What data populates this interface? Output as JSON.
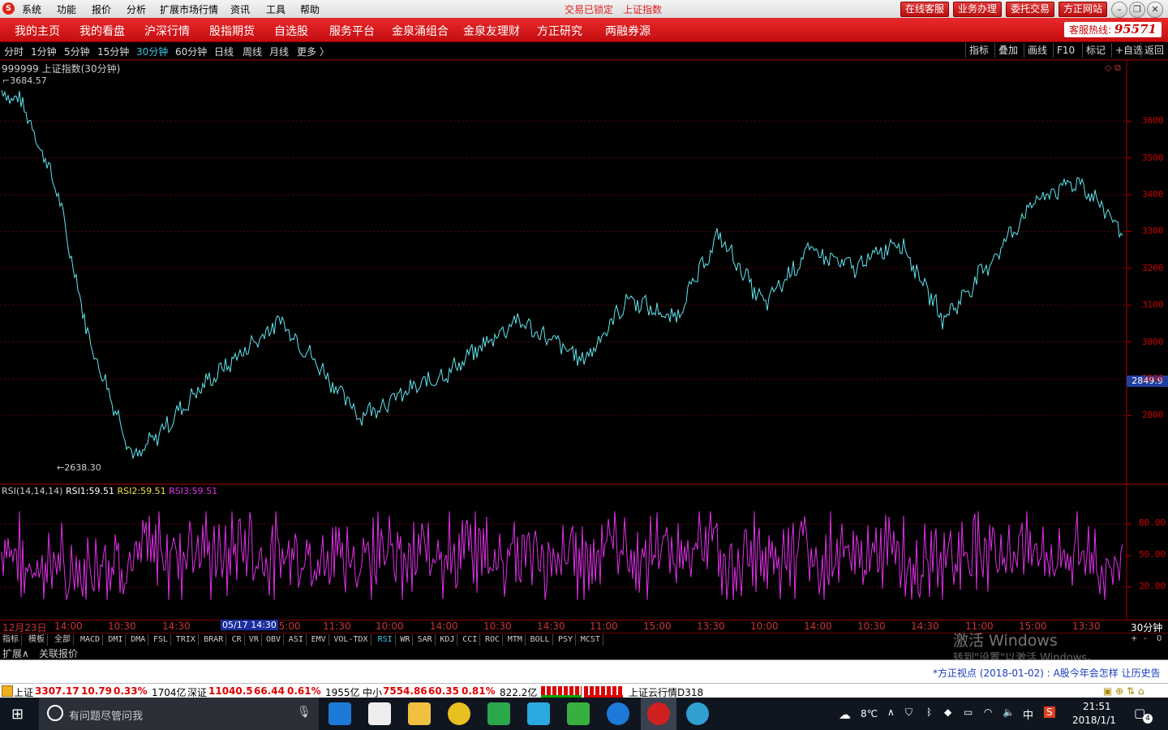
{
  "menubar": {
    "items": [
      "系统",
      "功能",
      "报价",
      "分析",
      "扩展市场行情",
      "资讯",
      "工具",
      "帮助"
    ],
    "status_locked": "交易已锁定",
    "status_index": "上证指数",
    "buttons": [
      "在线客服",
      "业务办理",
      "委托交易",
      "方正网站"
    ]
  },
  "navbar": {
    "items": [
      "我的主页",
      "我的看盘",
      "沪深行情",
      "股指期货",
      "自选股",
      "服务平台",
      "金泉涌组合",
      "金泉友理财",
      "方正研究",
      "两融券源"
    ],
    "hotline_label": "客服热线:",
    "hotline_number": "95571"
  },
  "periods": {
    "items": [
      "分时",
      "1分钟",
      "5分钟",
      "15分钟",
      "30分钟",
      "60分钟",
      "日线",
      "周线",
      "月线",
      "更多 〉"
    ],
    "active": "30分钟",
    "right_tools": [
      "指标",
      "叠加",
      "画线",
      "F10",
      "标记",
      "+自选",
      "返回"
    ]
  },
  "chart_data": [
    {
      "type": "line",
      "title": "999999 上证指数(30分钟)",
      "high_label": "3684.57",
      "low_label": "2638.30",
      "current_price": "2849.9",
      "yticks": [
        "3600",
        "3500",
        "3400",
        "3300",
        "3200",
        "3100",
        "3000",
        "2900",
        "2800"
      ],
      "ylim": [
        2620,
        3700
      ],
      "keypoints": {
        "x": [
          0,
          2,
          5,
          8,
          12,
          18,
          25,
          32,
          40,
          46,
          52,
          56,
          60,
          64,
          68,
          72,
          76,
          80,
          84,
          88,
          92,
          96,
          100
        ],
        "y": [
          3680,
          3650,
          3420,
          3000,
          2680,
          2880,
          3060,
          2800,
          2920,
          3060,
          2950,
          3120,
          3060,
          3290,
          3100,
          3250,
          3200,
          3280,
          3060,
          3210,
          3380,
          3440,
          3300
        ]
      }
    },
    {
      "type": "line",
      "title": "RSI(14,14,14)",
      "series": [
        {
          "name": "RSI1",
          "value": "59.51"
        },
        {
          "name": "RSI2",
          "value": "59.51"
        },
        {
          "name": "RSI3",
          "value": "59.51"
        }
      ],
      "yticks": [
        "80.00",
        "50.00",
        "20.00"
      ],
      "ylim": [
        0,
        100
      ]
    }
  ],
  "rsi_header": {
    "title": "RSI(14,14,14)",
    "rsi1_label": "RSI1:",
    "rsi1": "59.51",
    "rsi2_label": "RSI2:",
    "rsi2": "59.51",
    "rsi3_label": "RSI3:",
    "rsi3": "59.51"
  },
  "time_axis": {
    "start": "12月23日",
    "labels": [
      "14:00",
      "10:30",
      "14:30",
      "15:00",
      "11:30",
      "10:00",
      "14:00",
      "10:30",
      "14:30",
      "11:00",
      "15:00",
      "13:30",
      "10:00",
      "14:00",
      "10:30",
      "14:30",
      "11:00",
      "15:00",
      "13:30"
    ],
    "cursor": "05/17 14:30",
    "period": "30分钟"
  },
  "indicator_tabs": {
    "items": [
      "指标",
      "模板",
      "全部",
      "MACD",
      "DMI",
      "DMA",
      "FSL",
      "TRIX",
      "BRAR",
      "CR",
      "VR",
      "OBV",
      "ASI",
      "EMV",
      "VOL-TDX",
      "RSI",
      "WR",
      "SAR",
      "KDJ",
      "CCI",
      "ROC",
      "MTM",
      "BOLL",
      "PSY",
      "MCST"
    ],
    "active": "RSI",
    "controls": [
      "+",
      "-",
      "0"
    ]
  },
  "extbar": {
    "items": [
      "扩展∧",
      "关联报价"
    ]
  },
  "watermark": {
    "line1": "激活 Windows",
    "line2": "转到\"设置\"以激活 Windows。"
  },
  "news": {
    "text": "*方正视点 (2018-01-02) :  A股今年会怎样   让历史告"
  },
  "statusbar": {
    "sh_label": "上证",
    "sh_value": "3307.17",
    "sh_change": "10.79",
    "sh_pct": "0.33%",
    "sh_amount": "1704亿",
    "sz_label": "深证",
    "sz_value": "11040.5",
    "sz_change": "66.44",
    "sz_pct": "0.61%",
    "sz_amount": "1955亿",
    "zx_label": "中小",
    "zx_value": "7554.86",
    "zx_change": "60.35",
    "zx_pct": "0.81%",
    "zx_amount": "822.2亿",
    "cloud": "上证云行情D318"
  },
  "taskbar": {
    "search_placeholder": "有问题尽管问我",
    "weather": "8℃",
    "ime": "中",
    "time": "21:51",
    "date": "2018/1/1",
    "notifications": "4"
  }
}
